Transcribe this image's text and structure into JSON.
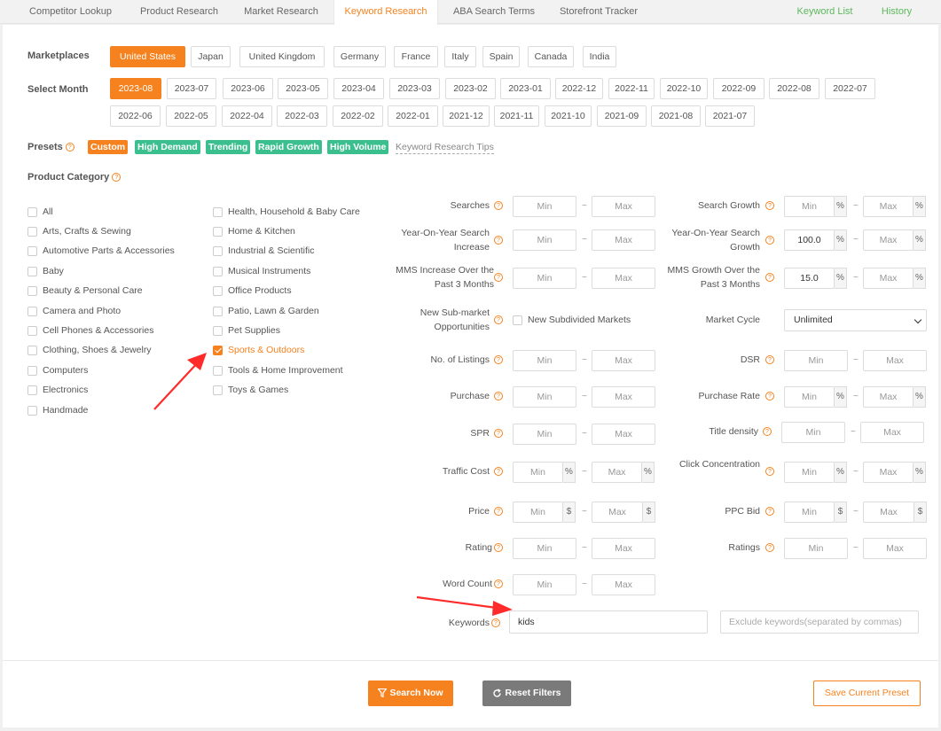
{
  "tabs": [
    {
      "label": "Competitor Lookup"
    },
    {
      "label": "Product Research"
    },
    {
      "label": "Market Research"
    },
    {
      "label": "Keyword Research"
    },
    {
      "label": "ABA Search Terms"
    },
    {
      "label": "Storefront Tracker"
    },
    {
      "label": "Keyword List"
    },
    {
      "label": "History"
    }
  ],
  "marketplaces": {
    "label": "Marketplaces",
    "selected": "United States",
    "items": [
      "United States",
      "Japan",
      "United Kingdom",
      "Germany",
      "France",
      "Italy",
      "Spain",
      "Canada",
      "India"
    ]
  },
  "months": {
    "label": "Select Month",
    "selected": "2023-08",
    "items": [
      "2023-08",
      "2023-07",
      "2023-06",
      "2023-05",
      "2023-04",
      "2023-03",
      "2023-02",
      "2023-01",
      "2022-12",
      "2022-11",
      "2022-10",
      "2022-09",
      "2022-08",
      "2022-07",
      "2022-06",
      "2022-05",
      "2022-04",
      "2022-03",
      "2022-02",
      "2022-01",
      "2021-12",
      "2021-11",
      "2021-10",
      "2021-09",
      "2021-08",
      "2021-07"
    ]
  },
  "presets": {
    "label": "Presets",
    "items": [
      "Custom",
      "High Demand",
      "Trending",
      "Rapid Growth",
      "High Volume"
    ],
    "tips": "Keyword Research Tips"
  },
  "category": {
    "label": "Product Category",
    "selected": "Sports & Outdoors",
    "items": [
      "All",
      "Arts, Crafts & Sewing",
      "Automotive Parts & Accessories",
      "Baby",
      "Beauty & Personal Care",
      "Camera and Photo",
      "Cell Phones & Accessories",
      "Clothing, Shoes & Jewelry",
      "Computers",
      "Electronics",
      "Handmade",
      "Health, Household & Baby Care",
      "Home & Kitchen",
      "Industrial & Scientific",
      "Musical Instruments",
      "Office Products",
      "Patio, Lawn & Garden",
      "Pet Supplies",
      "Sports & Outdoors",
      "Tools & Home Improvement",
      "Toys & Games"
    ]
  },
  "placeholders": {
    "min": "Min",
    "max": "Max"
  },
  "filters": {
    "searches": "Searches",
    "search_growth": "Search Growth",
    "yoy_search_increase": "Year-On-Year Search Increase",
    "yoy_search_growth": "Year-On-Year Search Growth",
    "yoy_search_growth_min": "100.0",
    "mms_increase": "MMS Increase Over the Past 3 Months",
    "mms_growth": "MMS Growth Over the Past 3 Months",
    "mms_growth_min": "15.0",
    "new_submarket": "New Sub-market Opportunities",
    "new_subdivided": "New Subdivided Markets",
    "market_cycle": "Market Cycle",
    "market_cycle_value": "Unlimited",
    "listings": "No. of Listings",
    "dsr": "DSR",
    "purchase": "Purchase",
    "purchase_rate": "Purchase Rate",
    "spr": "SPR",
    "title_density": "Title density",
    "traffic_cost": "Traffic Cost",
    "click_concentration": "Click Concentration",
    "price": "Price",
    "ppc_bid": "PPC Bid",
    "rating": "Rating",
    "ratings": "Ratings",
    "word_count": "Word Count",
    "keywords": "Keywords",
    "keywords_value": "kids",
    "exclude_placeholder": "Exclude keywords(separated by commas)"
  },
  "units": {
    "percent": "%",
    "dollar": "$",
    "tilde": "~"
  },
  "buttons": {
    "search": "Search Now",
    "reset": "Reset Filters",
    "save": "Save Current Preset"
  },
  "colors": {
    "accent": "#f5821f",
    "green": "#3cbf8e",
    "arrow": "#ff2a2a"
  }
}
